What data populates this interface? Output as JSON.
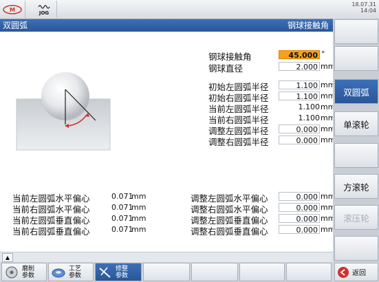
{
  "topbar": {
    "logo_label": "",
    "jog_label": "JOG",
    "date": "18.07.31",
    "time": "14:04"
  },
  "header": {
    "title": "双圆弧",
    "subtitle": "钢球接触角"
  },
  "params_top": [
    {
      "label": "钢球接触角",
      "value": "45.000",
      "unit": "°",
      "highlight": true
    },
    {
      "label": "钢球直径",
      "value": "2.000",
      "unit": "mm",
      "highlight": false
    }
  ],
  "params_radius": [
    {
      "label": "初始左圆弧半径",
      "value": "1.100",
      "unit": "mm"
    },
    {
      "label": "初始右圆弧半径",
      "value": "1.100",
      "unit": "mm"
    },
    {
      "label": "当前左圆弧半径",
      "value": "1.100",
      "unit": "mm"
    },
    {
      "label": "当前右圆弧半径",
      "value": "1.100",
      "unit": "mm"
    },
    {
      "label": "调整左圆弧半径",
      "value": "0.000",
      "unit": "mm"
    },
    {
      "label": "调整右圆弧半径",
      "value": "0.000",
      "unit": "mm"
    }
  ],
  "offsets_current": [
    {
      "label": "当前左圆弧水平偏心",
      "value": "0.071",
      "unit": "mm"
    },
    {
      "label": "当前右圆弧水平偏心",
      "value": "0.071",
      "unit": "mm"
    },
    {
      "label": "当前左圆弧垂直偏心",
      "value": "0.071",
      "unit": "mm"
    },
    {
      "label": "当前右圆弧垂直偏心",
      "value": "0.071",
      "unit": "mm"
    }
  ],
  "offsets_adjust": [
    {
      "label": "调整左圆弧水平偏心",
      "value": "0.000",
      "unit": "mm"
    },
    {
      "label": "调整右圆弧水平偏心",
      "value": "0.000",
      "unit": "mm"
    },
    {
      "label": "调整左圆弧垂直偏心",
      "value": "0.000",
      "unit": "mm"
    },
    {
      "label": "调整右圆弧垂直偏心",
      "value": "0.000",
      "unit": "mm"
    }
  ],
  "right_softkeys": [
    "",
    "",
    "双圆弧",
    "单滚轮",
    "",
    "方滚轮",
    "滚压轮",
    "",
    ""
  ],
  "bottom_softkeys": [
    {
      "line1": "磨削",
      "line2": "参数"
    },
    {
      "line1": "工艺",
      "line2": "参数"
    },
    {
      "line1": "修整",
      "line2": "参数"
    }
  ],
  "back_label": "返回",
  "colors": {
    "header": "#2f5fa6",
    "highlight": "#f7a01e",
    "accent_red": "#d0312d"
  }
}
